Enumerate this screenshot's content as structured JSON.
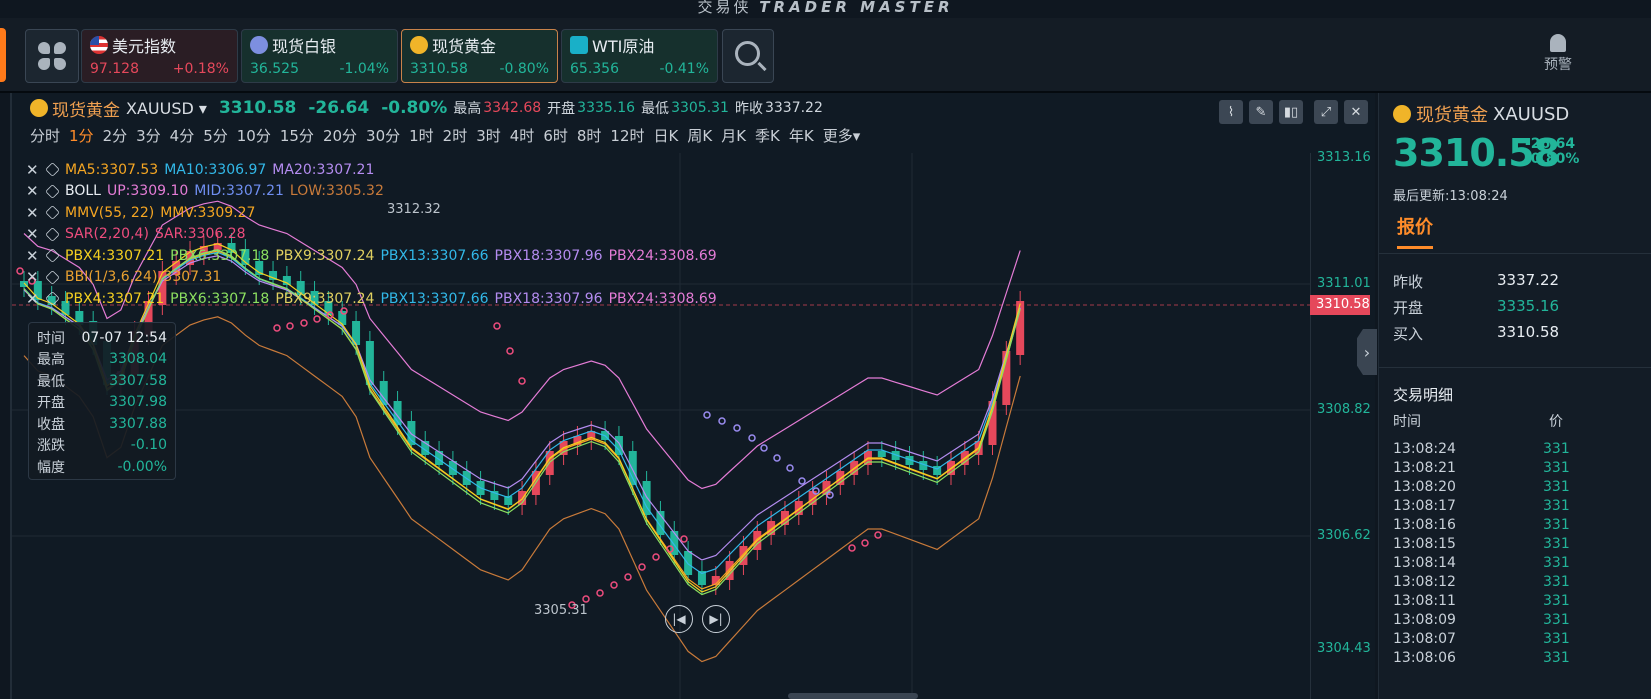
{
  "app": {
    "title_cn": "交易侠",
    "title_en": "TRADER MASTER"
  },
  "tickers": [
    {
      "name": "美元指数",
      "price": "97.128",
      "change": "+0.18%",
      "icon": "us-flag-icon"
    },
    {
      "name": "现货白银",
      "price": "36.525",
      "change": "-1.04%",
      "icon": "silver-icon"
    },
    {
      "name": "现货黄金",
      "price": "3310.58",
      "change": "-0.80%",
      "icon": "gold-icon"
    },
    {
      "name": "WTI原油",
      "price": "65.356",
      "change": "-0.41%",
      "icon": "oil-icon"
    }
  ],
  "alert_label": "预警",
  "chart": {
    "name": "现货黄金",
    "symbol": "XAUUSD",
    "price": "3310.58",
    "change": "-26.64",
    "change_pct": "-0.80%",
    "high_label": "最高",
    "high": "3342.68",
    "open_label": "开盘",
    "open": "3335.16",
    "low_label": "最低",
    "low": "3305.31",
    "prev_label": "昨收",
    "prev": "3337.22"
  },
  "periods": [
    "分时",
    "1分",
    "2分",
    "3分",
    "4分",
    "5分",
    "10分",
    "15分",
    "20分",
    "30分",
    "1时",
    "2时",
    "3时",
    "4时",
    "6时",
    "8时",
    "12时",
    "日K",
    "周K",
    "月K",
    "季K",
    "年K",
    "更多"
  ],
  "active_period": "1分",
  "indicators": {
    "ma": {
      "ma5": "MA5:3307.53",
      "ma10": "MA10:3306.97",
      "ma20": "MA20:3307.21"
    },
    "boll": {
      "name": "BOLL",
      "up": "UP:3309.10",
      "mid": "MID:3307.21",
      "low": "LOW:3305.32"
    },
    "mmv": {
      "name": "MMV(55, 22)",
      "val": "MMV:3309.27"
    },
    "sar": {
      "name": "SAR(2,20,4)",
      "val": "SAR:3306.28"
    },
    "pbx": {
      "p4": "PBX4:3307.21",
      "p6": "PBX6:3307.18",
      "p9": "PBX9:3307.24",
      "p13": "PBX13:3307.66",
      "p18": "PBX18:3307.96",
      "p24": "PBX24:3308.69"
    },
    "bbi": {
      "name": "BBI(1/3,6,24)",
      "val": "3307.31"
    }
  },
  "tooltip": {
    "rows": [
      {
        "k": "时间",
        "v": "07-07 12:54"
      },
      {
        "k": "最高",
        "v": "3308.04"
      },
      {
        "k": "最低",
        "v": "3307.58"
      },
      {
        "k": "开盘",
        "v": "3307.98"
      },
      {
        "k": "收盘",
        "v": "3307.88"
      },
      {
        "k": "涨跌",
        "v": "-0.10"
      },
      {
        "k": "幅度",
        "v": "-0.00%"
      }
    ]
  },
  "axis_ticks": [
    "3313.16",
    "3311.01",
    "3308.82",
    "3306.62",
    "3304.43"
  ],
  "axis_current": "3310.58",
  "chart_high_mark": "3312.32",
  "chart_low_mark": "3305.31",
  "right_panel": {
    "name": "现货黄金",
    "symbol": "XAUUSD",
    "price": "3310.58",
    "change": "-26.64",
    "change_pct": "-0.80%",
    "updated": "最后更新:13:08:24",
    "tab": "报价",
    "quote": [
      {
        "k": "昨收",
        "v": "3337.22"
      },
      {
        "k": "开盘",
        "v": "3335.16"
      },
      {
        "k": "买入",
        "v": "3310.58"
      }
    ],
    "trades_title": "交易明细",
    "trades_col_time": "时间",
    "trades_col_price": "价",
    "trades": [
      "13:08:24",
      "13:08:21",
      "13:08:20",
      "13:08:17",
      "13:08:16",
      "13:08:15",
      "13:08:14",
      "13:08:12",
      "13:08:11",
      "13:08:09",
      "13:08:07",
      "13:08:06"
    ],
    "trade_price_prefix": "331"
  },
  "colors": {
    "up": "#e5485b",
    "down": "#22b59a",
    "accent": "#ff8c2a",
    "bg": "#101a24"
  }
}
